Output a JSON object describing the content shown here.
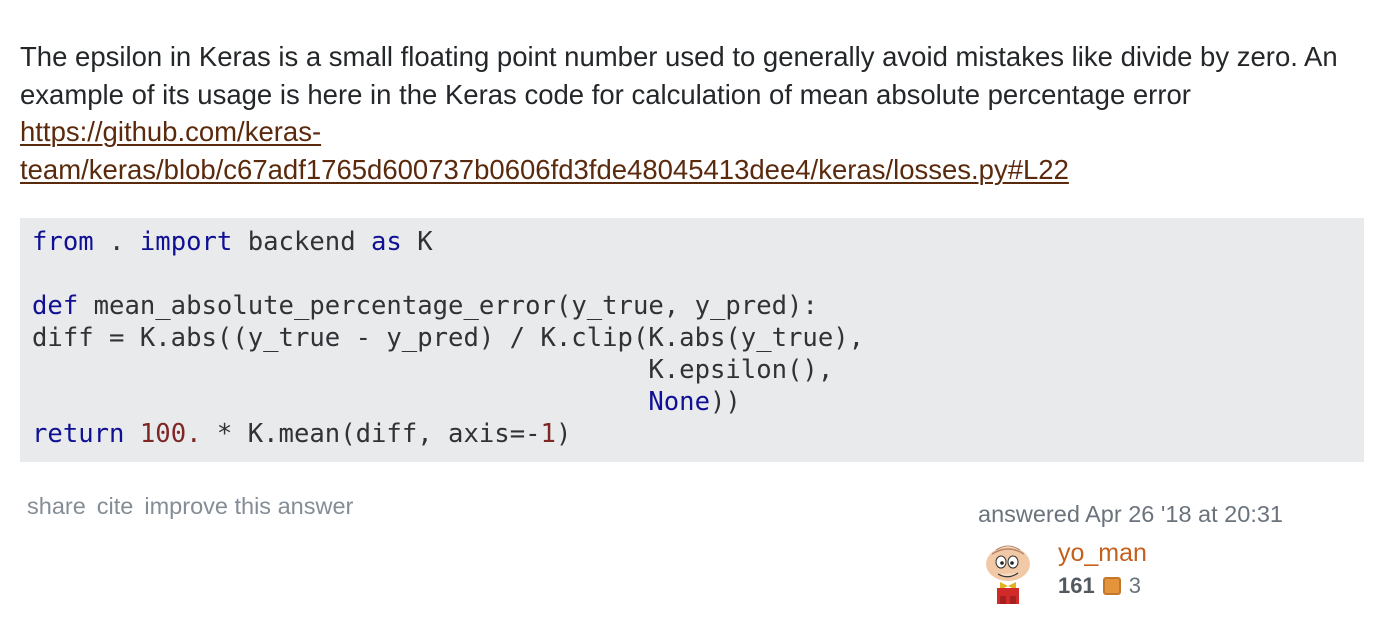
{
  "answer": {
    "text_part1": "The epsilon in Keras is a small floating point number used to generally avoid mistakes like divide by zero. An example of its usage is here in the Keras code for calculation of mean absolute percentage error ",
    "link_text": "https://github.com/keras-team/keras/blob/c67adf1765d600737b0606fd3fde48045413dee4/keras/losses.py#L22"
  },
  "code": {
    "line1": {
      "kw1": "from",
      "t1": " . ",
      "kw2": "import",
      "t2": " backend ",
      "kw3": "as",
      "t3": " K"
    },
    "line3": {
      "kw": "def",
      "t": " mean_absolute_percentage_error(y_true, y_pred):"
    },
    "line4": "diff = K.abs((y_true - y_pred) / K.clip(K.abs(y_true),",
    "line5": "                                        K.epsilon(),",
    "line6_indent": "                                        ",
    "line6_const": "None",
    "line6_tail": "))",
    "line7": {
      "kw": "return",
      "sp": " ",
      "num": "100.",
      "t": " * K.mean(diff, axis=-",
      "num2": "1",
      "t2": ")"
    }
  },
  "post_menu": {
    "share": "share",
    "cite": "cite",
    "improve": "improve this answer"
  },
  "user": {
    "action_time": "answered Apr 26 '18 at 20:31",
    "name": "yo_man",
    "reputation": "161",
    "bronze_badges": "3",
    "bronze_color": "#e4953c"
  }
}
